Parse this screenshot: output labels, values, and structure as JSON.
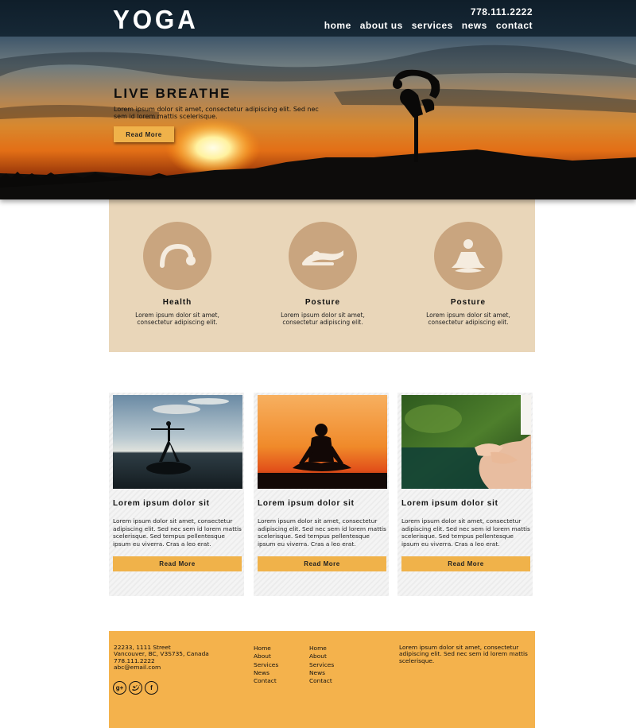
{
  "header": {
    "logo": "YOGA",
    "phone": "778.111.2222",
    "nav": [
      "home",
      "about us",
      "services",
      "news",
      "contact"
    ]
  },
  "hero": {
    "title": "LIVE BREATHE",
    "text": "Lorem ipsum dolor sit amet, consectetur adipiscing elit. Sed nec sem id lorem mattis scelerisque.",
    "button": "Read More"
  },
  "features": [
    {
      "icon": "health-icon",
      "title": "Health",
      "text": "Lorem ipsum dolor sit amet, consectetur adipiscing elit."
    },
    {
      "icon": "posture-icon",
      "title": "Posture",
      "text": "Lorem ipsum dolor sit amet, consectetur adipiscing elit."
    },
    {
      "icon": "meditation-icon",
      "title": "Posture",
      "text": "Lorem ipsum dolor sit amet, consectetur adipiscing elit."
    }
  ],
  "cards": [
    {
      "title": "Lorem ipsum dolor sit",
      "text": "Lorem ipsum dolor sit amet, consectetur adipiscing elit. Sed nec sem id lorem mattis scelerisque. Sed tempus pellentesque ipsum eu viverra. Cras a leo erat.",
      "button": "Read More"
    },
    {
      "title": "Lorem ipsum dolor sit",
      "text": "Lorem ipsum dolor sit amet, consectetur adipiscing elit. Sed nec sem id lorem mattis scelerisque. Sed tempus pellentesque ipsum eu viverra. Cras a leo erat.",
      "button": "Read More"
    },
    {
      "title": "Lorem ipsum dolor sit",
      "text": "Lorem ipsum dolor sit amet, consectetur adipiscing elit. Sed nec sem id lorem mattis scelerisque. Sed tempus pellentesque ipsum eu viverra. Cras a leo erat.",
      "button": "Read More"
    }
  ],
  "footer": {
    "address": [
      "22233, 1111 Street",
      "Vancouver, BC, V3S735, Canada",
      "778.111.2222",
      "abc@email.com"
    ],
    "social": [
      "google-plus-icon",
      "twitter-icon",
      "facebook-icon"
    ],
    "links_col1": [
      "Home",
      "About",
      "Services",
      "News",
      "Contact"
    ],
    "links_col2": [
      "Home",
      "About",
      "Services",
      "News",
      "Contact"
    ],
    "blurb": "Lorem ipsum dolor sit amet, consectetur adipiscing elit. Sed nec sem id lorem mattis scelerisque."
  },
  "colors": {
    "header_bg": "#112230",
    "accent": "#f0b24a",
    "feature_bg": "#e9d6b9",
    "feature_circle": "#c9a57f",
    "footer_bg": "#f4b24c"
  }
}
